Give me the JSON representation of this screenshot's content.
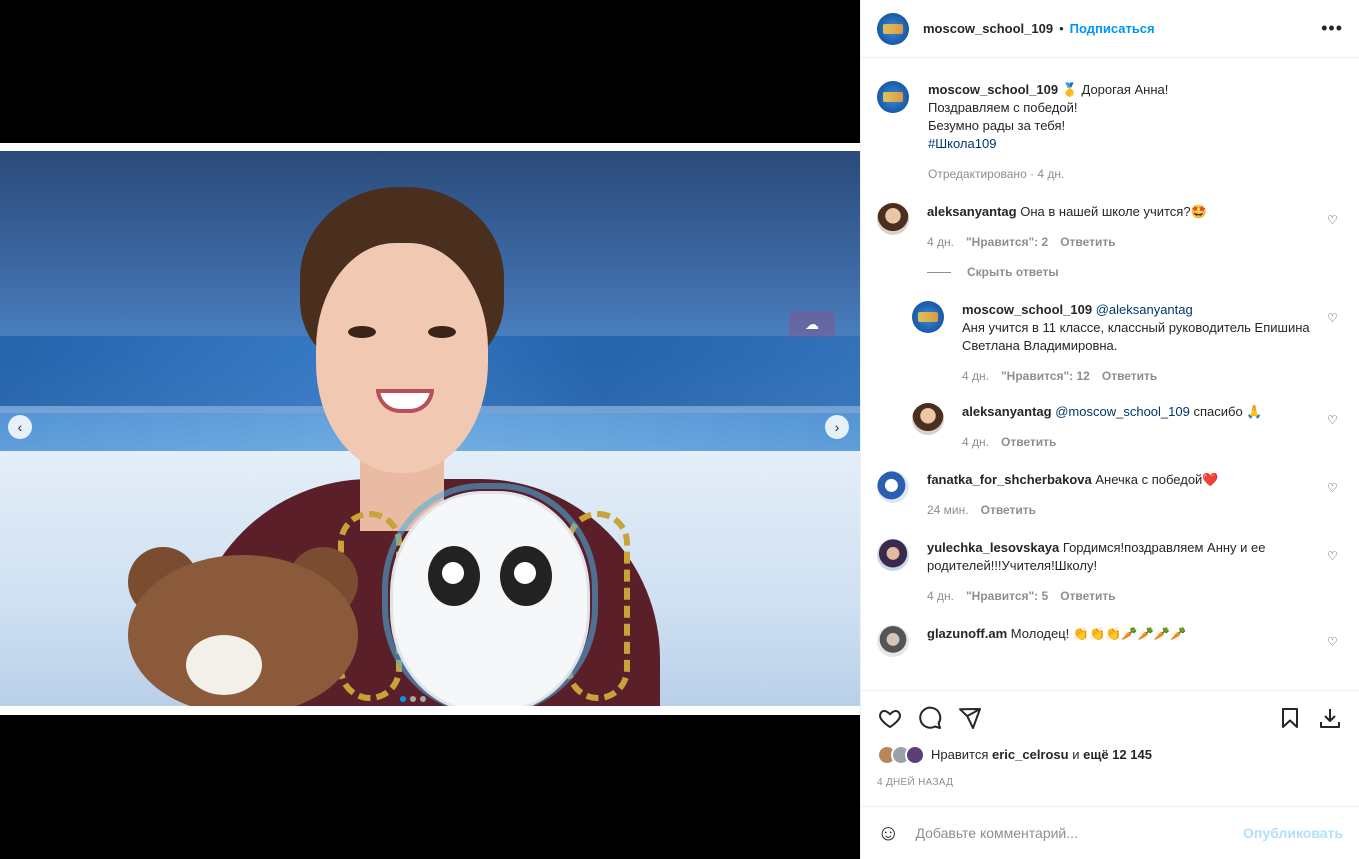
{
  "post": {
    "author": "moscow_school_109",
    "follow_label": "Подписаться",
    "more_label": "•••",
    "caption_emoji": "🥇",
    "caption_line1": "Дорогая Анна!",
    "caption_line2": "Поздравляем с победой!",
    "caption_line3": "Безумно рады за тебя!",
    "hashtag": "#Школа109",
    "caption_meta": "Отредактировано · 4 дн."
  },
  "comments": [
    {
      "user": "aleksanyantag",
      "text": "Она в нашей школе учится?🤩",
      "time": "4 дн.",
      "likes": "\"Нравится\": 2",
      "reply": "Ответить",
      "hide_replies": "Скрыть ответы",
      "replies": [
        {
          "user": "moscow_school_109",
          "mention": "@aleksanyantag",
          "text": "Аня учится в 11 классе, классный руководитель Епишина Светлана Владимировна.",
          "time": "4 дн.",
          "likes": "\"Нравится\": 12",
          "reply": "Ответить"
        },
        {
          "user": "aleksanyantag",
          "mention": "@moscow_school_109",
          "text": "спасибо 🙏",
          "time": "4 дн.",
          "reply": "Ответить"
        }
      ]
    },
    {
      "user": "fanatka_for_shcherbakova",
      "text": "Анечка с победой❤️",
      "time": "24 мин.",
      "reply": "Ответить"
    },
    {
      "user": "yulechka_lesovskaya",
      "text": "Гордимся!поздравляем Анну и ее родителей!!!Учителя!Школу!",
      "time": "4 дн.",
      "likes": "\"Нравится\": 5",
      "reply": "Ответить"
    },
    {
      "user": "glazunoff.am",
      "text": "Молодец! 👏👏👏🥕🥕🥕🥕"
    }
  ],
  "actions": {
    "liked_by_prefix": "Нравится",
    "liked_by_user": "eric_celrosu",
    "liked_by_and": "и",
    "liked_by_more": "ещё 12 145",
    "date": "4 ДНЕЙ НАЗАД"
  },
  "composer": {
    "emoji": "☺",
    "placeholder": "Добавьте комментарий...",
    "publish_label": "Опубликовать"
  },
  "colors": {
    "accent": "#0095f6",
    "link": "#00376b",
    "muted": "#8e8e8e",
    "publish_disabled": "#b2dffc"
  },
  "icons": [
    "chevron-left-icon",
    "chevron-right-icon",
    "heart-icon",
    "comment-icon",
    "share-icon",
    "bookmark-icon",
    "download-icon",
    "emoji-icon",
    "more-icon"
  ]
}
